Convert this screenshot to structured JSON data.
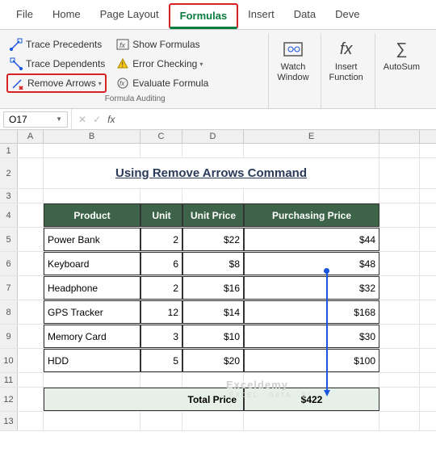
{
  "tabs": {
    "file": "File",
    "home": "Home",
    "page_layout": "Page Layout",
    "formulas": "Formulas",
    "insert": "Insert",
    "data": "Data",
    "dev": "Deve"
  },
  "ribbon": {
    "trace_precedents": "Trace Precedents",
    "trace_dependents": "Trace Dependents",
    "remove_arrows": "Remove Arrows",
    "show_formulas": "Show Formulas",
    "error_checking": "Error Checking",
    "evaluate_formula": "Evaluate Formula",
    "watch_window": "Watch Window",
    "insert_function": "Insert Function",
    "autosum": "AutoSum",
    "group_label": "Formula Auditing"
  },
  "namebox": "O17",
  "columns": [
    "A",
    "B",
    "C",
    "D",
    "E"
  ],
  "title": "Using Remove  Arrows Command",
  "headers": {
    "product": "Product",
    "unit": "Unit",
    "unit_price": "Unit Price",
    "purchasing_price": "Purchasing Price"
  },
  "rows": [
    {
      "product": "Power Bank",
      "unit": "2",
      "unit_price": "$22",
      "purchasing": "$44"
    },
    {
      "product": "Keyboard",
      "unit": "6",
      "unit_price": "$8",
      "purchasing": "$48"
    },
    {
      "product": "Headphone",
      "unit": "2",
      "unit_price": "$16",
      "purchasing": "$32"
    },
    {
      "product": "GPS Tracker",
      "unit": "12",
      "unit_price": "$14",
      "purchasing": "$168"
    },
    {
      "product": "Memory Card",
      "unit": "3",
      "unit_price": "$10",
      "purchasing": "$30"
    },
    {
      "product": "HDD",
      "unit": "5",
      "unit_price": "$20",
      "purchasing": "$100"
    }
  ],
  "total": {
    "label": "Total Price",
    "value": "$422"
  },
  "watermark": {
    "main": "Exceldemy",
    "sub": "EXCEL · DATA · BI"
  }
}
